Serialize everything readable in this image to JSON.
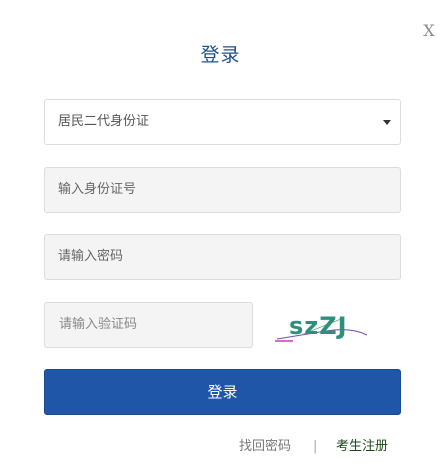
{
  "dialog": {
    "close_label": "X",
    "title": "登录"
  },
  "form": {
    "id_type": {
      "selected": "居民二代身份证"
    },
    "id_number": {
      "placeholder": "输入身份证号"
    },
    "password": {
      "placeholder": "请输入密码"
    },
    "captcha": {
      "placeholder": "请输入验证码",
      "image_text": "szZJ"
    },
    "submit_label": "登录"
  },
  "footer": {
    "forgot_label": "找回密码",
    "divider": "|",
    "register_label": "考生注册"
  },
  "colors": {
    "title": "#1f4f8f",
    "primary_button": "#1f56a8",
    "captcha_text": "#2f8f7f"
  }
}
